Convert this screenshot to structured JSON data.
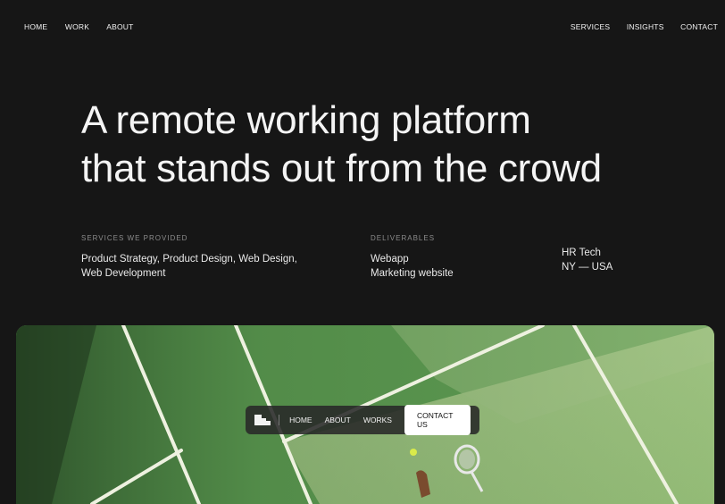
{
  "nav_left": [
    "HOME",
    "WORK",
    "ABOUT"
  ],
  "nav_right": [
    "SERVICES",
    "INSIGHTS",
    "CONTACT"
  ],
  "hero": {
    "line1": "A remote working platform",
    "line2": "that stands out from the crowd"
  },
  "services": {
    "label": "SERVICES WE PROVIDED",
    "line1": "Product Strategy, Product Design, Web Design,",
    "line2": "Web Development"
  },
  "deliverables": {
    "label": "DELIVERABLES",
    "items": [
      "Webapp",
      "Marketing website"
    ]
  },
  "client": {
    "industry": "HR Tech",
    "location": "NY — USA"
  },
  "mockup_nav": {
    "links": [
      "HOME",
      "ABOUT",
      "WORKS"
    ],
    "cta": "CONTACT US"
  },
  "colors": {
    "background": "#161616",
    "court": "#6aa55c",
    "court_light": "#a8c889",
    "text": "#f2f2f2"
  },
  "icons": {
    "brand": "square-blocks-logo-icon"
  }
}
